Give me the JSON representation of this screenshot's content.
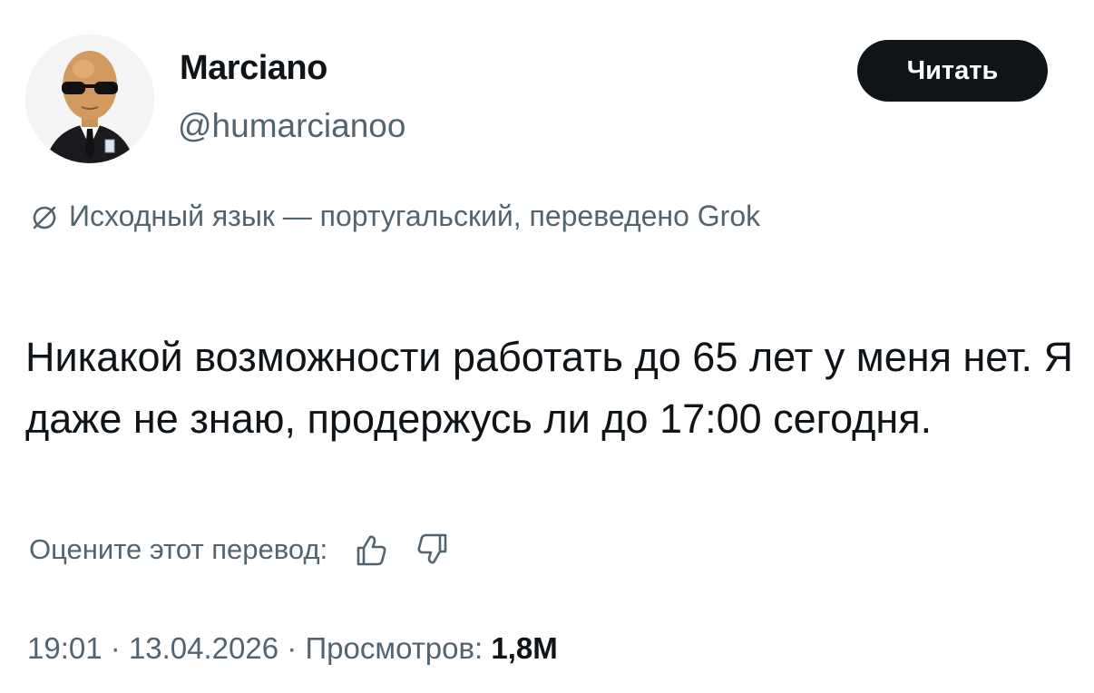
{
  "author": {
    "display_name": "Marciano",
    "handle": "@humarcianoo"
  },
  "follow_button": {
    "label": "Читать"
  },
  "translation_notice": {
    "text": "Исходный язык — португальский, переведено Grok",
    "icon": "globe-slash-icon"
  },
  "tweet": {
    "text": "Никакой возможности работать до 65 лет у меня нет. Я даже не знаю, продержусь ли до 17:00 сегодня."
  },
  "rating": {
    "prompt": "Оцените этот перевод:",
    "like_icon": "thumbs-up-icon",
    "dislike_icon": "thumbs-down-icon"
  },
  "meta": {
    "time": "19:01",
    "separator": "·",
    "date": "13.04.2026",
    "views_label": "Просмотров:",
    "views_count": "1,8M"
  },
  "colors": {
    "text_primary": "#0f1419",
    "text_secondary": "#536471",
    "button_bg": "#0f1419"
  }
}
